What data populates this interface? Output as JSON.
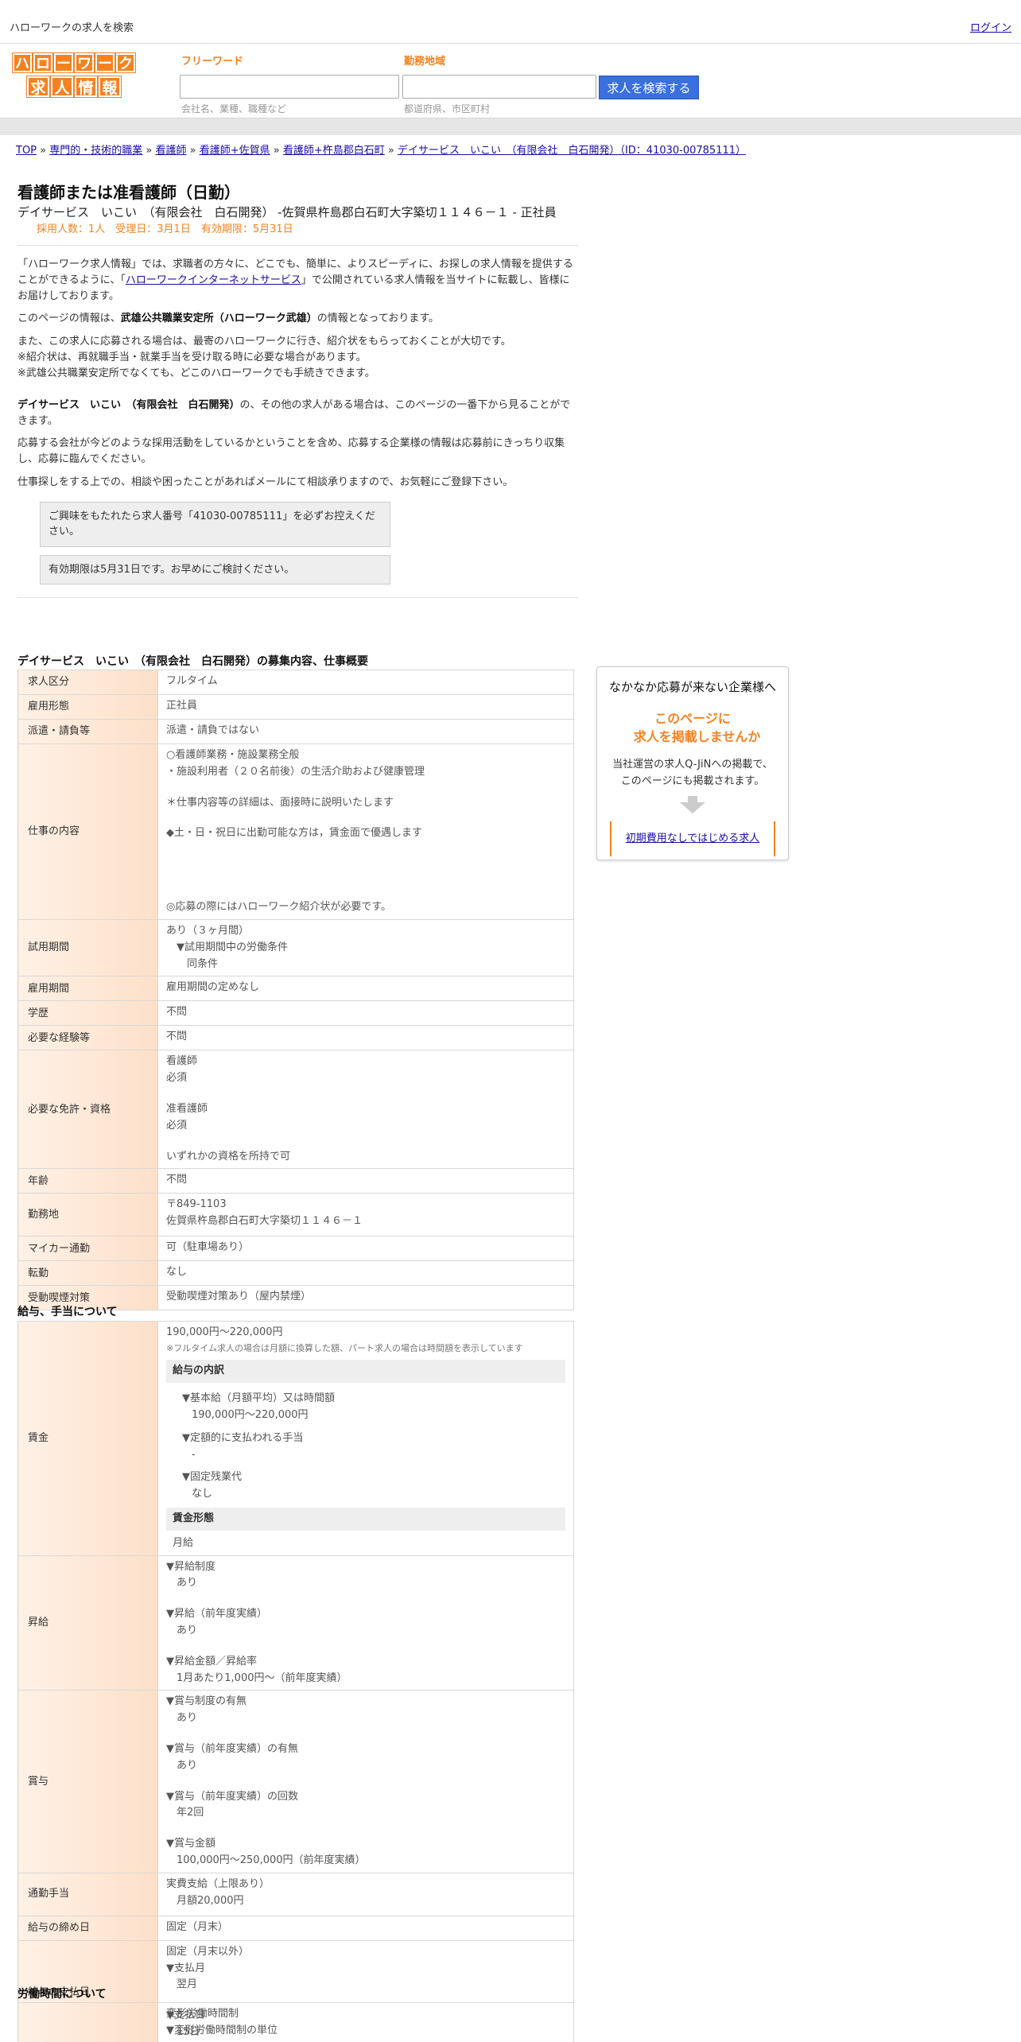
{
  "topbar": {
    "title": "ハローワークの求人を検索",
    "login": "ログイン"
  },
  "logo": {
    "row1": [
      "ハ",
      "ロ",
      "ー",
      "ワ",
      "ー",
      "ク"
    ],
    "row2": [
      "求",
      "人",
      "情",
      "報"
    ]
  },
  "search": {
    "keyword_label": "フリーワード",
    "keyword_placeholder": "会社名、業種、職種など",
    "area_label": "勤務地域",
    "area_placeholder": "都道府県、市区町村",
    "button": "求人を検索する"
  },
  "breadcrumb": {
    "items": [
      "TOP",
      "専門的・技術的職業",
      "看護師",
      "看護師+佐賀県",
      "看護師+杵島郡白石町",
      "デイサービス　いこい　（有限会社　白石開発）（ID：41030-00785111）"
    ],
    "sep": " » "
  },
  "job": {
    "title": "看護師または准看護師（日勤）",
    "subtitle": "デイサービス　いこい　（有限会社　白石開発） -佐賀県杵島郡白石町大字築切１１４６－１ - 正社員",
    "meta": "採用人数：1人　受理日：3月1日　有効期限：5月31日"
  },
  "intro": {
    "p1_a": "「ハローワーク求人情報」では、求職者の方々に、どこでも、簡単に、よりスピーディに、お探しの求人情報を提供することができるように、「",
    "p1_link": "ハローワークインターネットサービス",
    "p1_b": "」で公開されている求人情報を当サイトに転載し、皆様にお届けしております。",
    "p2_a": "このページの情報は、",
    "p2_b": "武雄公共職業安定所（ハローワーク武雄）",
    "p2_c": "の情報となっております。",
    "p3_1": "また、この求人に応募される場合は、最寄のハローワークに行き、紹介状をもらっておくことが大切です。",
    "p3_2": "※紹介状は、再就職手当・就業手当を受け取る時に必要な場合があります。",
    "p3_3": "※武雄公共職業安定所でなくても、どこのハローワークでも手続きできます。",
    "p4_a": "デイサービス　いこい　（有限会社　白石開発）",
    "p4_b": "の、その他の求人がある場合は、このページの一番下から見ることができます。",
    "p5": "応募する会社が今どのような採用活動をしているかということを含め、応募する企業様の情報は応募前にきっちり収集し、応募に臨んでください。",
    "p6": "仕事探しをする上での、相談や困ったことがあればメールにて相談承りますので、お気軽にご登録下さい。",
    "note1": "ご興味をもたれたら求人番号「41030-00785111」を必ずお控えください。",
    "note2": "有効期限は5月31日です。お早めにご検討ください。"
  },
  "overview": {
    "title": "デイサービス　いこい　（有限会社　白石開発）の募集内容、仕事概要",
    "rows": [
      {
        "k": "求人区分",
        "v": [
          "フルタイム"
        ]
      },
      {
        "k": "雇用形態",
        "v": [
          "正社員"
        ]
      },
      {
        "k": "派遣・請負等",
        "v": [
          "派遣・請負ではない"
        ]
      },
      {
        "k": "仕事の内容",
        "v": [
          "○看護師業務・施設業務全般",
          "・施設利用者（２０名前後）の生活介助および健康管理",
          "",
          "＊仕事内容等の詳細は、面接時に説明いたします",
          "",
          "◆土・日・祝日に出勤可能な方は，賃金面で優遇します",
          "",
          "",
          "",
          "",
          "◎応募の際にはハローワーク紹介状が必要です。"
        ]
      },
      {
        "k": "試用期間",
        "v": [
          "あり（３ヶ月間）",
          "　▼試用期間中の労働条件",
          "　　同条件"
        ]
      },
      {
        "k": "雇用期間",
        "v": [
          "雇用期間の定めなし"
        ]
      },
      {
        "k": "学歴",
        "v": [
          "不問"
        ]
      },
      {
        "k": "必要な経験等",
        "v": [
          "不問"
        ]
      },
      {
        "k": "必要な免許・資格",
        "v": [
          "看護師",
          "必須",
          "",
          "准看護師",
          "必須",
          "",
          "いずれかの資格を所持で可"
        ]
      },
      {
        "k": "年齢",
        "v": [
          "不問"
        ]
      },
      {
        "k": "勤務地",
        "v": [
          "〒849-1103",
          "佐賀県杵島郡白石町大字築切１１４６－１"
        ]
      },
      {
        "k": "マイカー通勤",
        "v": [
          "可（駐車場あり）"
        ]
      },
      {
        "k": "転勤",
        "v": [
          "なし"
        ]
      },
      {
        "k": "受動喫煙対策",
        "v": [
          "受動喫煙対策あり（屋内禁煙）"
        ]
      }
    ]
  },
  "salary": {
    "title": "給与、手当について",
    "wage_label": "賃金",
    "wage_value": "190,000円〜220,000円",
    "wage_note": "※フルタイム求人の場合は月額に換算した額、パート求人の場合は時間額を表示しています",
    "breakdown_title": "給与の内訳",
    "base_label": "▼基本給（月額平均）又は時間額",
    "base_value": "190,000円〜220,000円",
    "fixed_label": "▼定額的に支払われる手当",
    "fixed_value": "-",
    "overtime_label": "▼固定残業代",
    "overtime_value": "なし",
    "form_title": "賃金形態",
    "form_value": "月給",
    "raise_label": "昇給",
    "raise": [
      "▼昇給制度",
      "　あり",
      "",
      "▼昇給（前年度実績）",
      "　あり",
      "",
      "▼昇給金額／昇給率",
      "　1月あたり1,000円〜（前年度実績）"
    ],
    "bonus_label": "賞与",
    "bonus": [
      "▼賞与制度の有無",
      "　あり",
      "",
      "▼賞与（前年度実績）の有無",
      "　あり",
      "",
      "▼賞与（前年度実績）の回数",
      "　年2回",
      "",
      "▼賞与金額",
      "　100,000円〜250,000円（前年度実績）"
    ],
    "commute_label": "通勤手当",
    "commute": [
      "実費支給（上限あり）",
      "　月額20,000円"
    ],
    "close_label": "給与の締め日",
    "close": [
      "固定（月末）"
    ],
    "pay_label": "給与の支払日",
    "pay": [
      "固定（月末以外）",
      "▼支払月",
      "　翌月",
      "",
      "▼支払日",
      "　15日"
    ]
  },
  "worktime": {
    "title": "労働時間について",
    "v": [
      "変形労働時間制",
      "▼変形労働時間制の単位"
    ]
  },
  "side": {
    "heading": "なかなか応募が来ない企業様へ",
    "offer_1": "このページに",
    "offer_2": "求人を掲載しませんか",
    "body_1": "当社運営の求人Q-JiNへの掲載で、",
    "body_2": "このページにも掲載されます。",
    "link": "初期費用なしではじめる求人"
  }
}
